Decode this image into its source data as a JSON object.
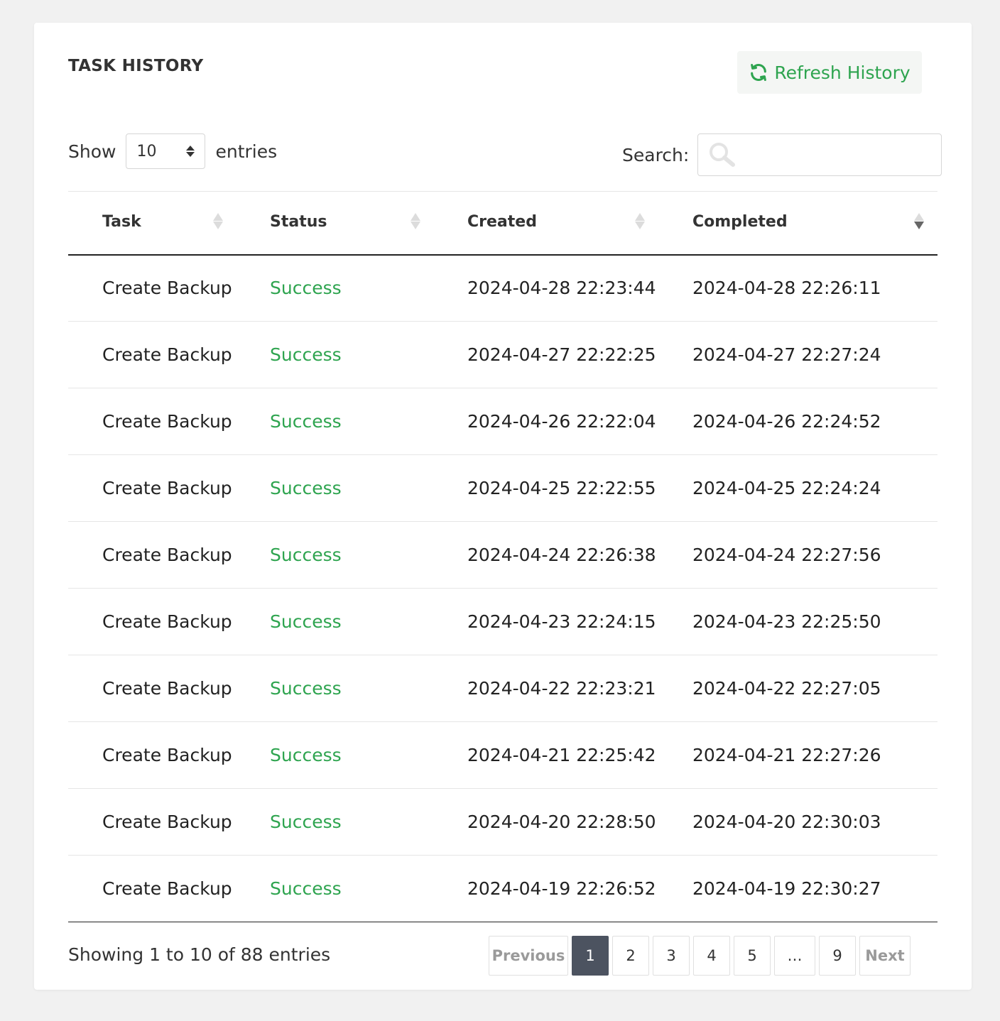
{
  "title": "TASK HISTORY",
  "refresh_button": {
    "label": "Refresh History",
    "icon": "refresh-icon",
    "color": "#2ea44f"
  },
  "length_control": {
    "prefix": "Show",
    "value": "10",
    "suffix": "entries"
  },
  "search": {
    "label": "Search:",
    "placeholder": "",
    "value": ""
  },
  "table": {
    "columns": [
      "Task",
      "Status",
      "Created",
      "Completed"
    ],
    "sorted_column": "Completed",
    "sort_direction": "descending",
    "rows": [
      {
        "task": "Create Backup",
        "status": "Success",
        "created": "2024-04-28 22:23:44",
        "completed": "2024-04-28 22:26:11"
      },
      {
        "task": "Create Backup",
        "status": "Success",
        "created": "2024-04-27 22:22:25",
        "completed": "2024-04-27 22:27:24"
      },
      {
        "task": "Create Backup",
        "status": "Success",
        "created": "2024-04-26 22:22:04",
        "completed": "2024-04-26 22:24:52"
      },
      {
        "task": "Create Backup",
        "status": "Success",
        "created": "2024-04-25 22:22:55",
        "completed": "2024-04-25 22:24:24"
      },
      {
        "task": "Create Backup",
        "status": "Success",
        "created": "2024-04-24 22:26:38",
        "completed": "2024-04-24 22:27:56"
      },
      {
        "task": "Create Backup",
        "status": "Success",
        "created": "2024-04-23 22:24:15",
        "completed": "2024-04-23 22:25:50"
      },
      {
        "task": "Create Backup",
        "status": "Success",
        "created": "2024-04-22 22:23:21",
        "completed": "2024-04-22 22:27:05"
      },
      {
        "task": "Create Backup",
        "status": "Success",
        "created": "2024-04-21 22:25:42",
        "completed": "2024-04-21 22:27:26"
      },
      {
        "task": "Create Backup",
        "status": "Success",
        "created": "2024-04-20 22:28:50",
        "completed": "2024-04-20 22:30:03"
      },
      {
        "task": "Create Backup",
        "status": "Success",
        "created": "2024-04-19 22:26:52",
        "completed": "2024-04-19 22:30:27"
      }
    ]
  },
  "footer": {
    "info": "Showing 1 to 10 of 88 entries",
    "pagination": {
      "previous": "Previous",
      "pages": [
        "1",
        "2",
        "3",
        "4",
        "5",
        "…",
        "9"
      ],
      "current": "1",
      "next": "Next"
    }
  },
  "colors": {
    "accent_green": "#2ea44f",
    "active_page_bg": "#4c5360",
    "page_background": "#f1f1f1"
  }
}
